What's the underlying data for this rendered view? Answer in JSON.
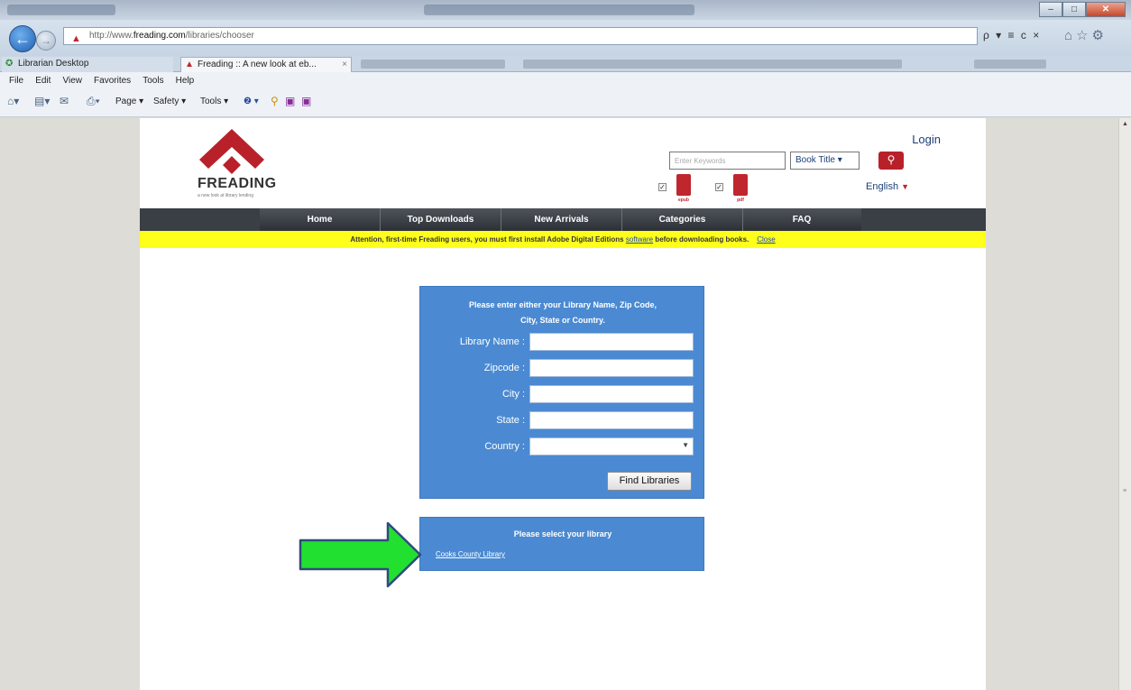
{
  "browser": {
    "address_url_prefix": "http://www.",
    "address_url_host": "freading.com",
    "address_url_path": "/libraries/chooser",
    "address_tools": "ρ ▾ ≡ c ×",
    "tabs": [
      {
        "label": "Librarian Desktop"
      },
      {
        "label": "Freading :: A new look at eb...",
        "close": "×"
      }
    ],
    "menu": [
      "File",
      "Edit",
      "View",
      "Favorites",
      "Tools",
      "Help"
    ],
    "commands": {
      "page": "Page ▾",
      "safety": "Safety ▾",
      "tools": "Tools ▾",
      "help": "❷ ▾"
    },
    "window_buttons": {
      "minimize": "–",
      "maximize": "□",
      "close": "✕"
    }
  },
  "site": {
    "logo_text": "FREADING",
    "logo_tagline": "a new look at library lending",
    "login_label": "Login",
    "search": {
      "keyword_placeholder": "Enter Keywords",
      "scope_label": "Book Title ▾",
      "button_icon": "search-icon"
    },
    "formats": [
      {
        "label": "epub"
      },
      {
        "label": "pdf"
      }
    ],
    "language": "English",
    "nav": [
      "Home",
      "Top Downloads",
      "New Arrivals",
      "Categories",
      "FAQ"
    ],
    "notice": {
      "text_before": "Attention, first-time Freading users, you must first install Adobe Digital Editions ",
      "link": "software",
      "text_after": " before downloading books.",
      "close": "Close"
    }
  },
  "library_search": {
    "title_line1": "Please enter either your Library Name, Zip Code,",
    "title_line2": "City, State or Country.",
    "fields": [
      {
        "label": "Library Name :",
        "value": ""
      },
      {
        "label": "Zipcode :",
        "value": ""
      },
      {
        "label": "City :",
        "value": ""
      },
      {
        "label": "State :",
        "value": ""
      },
      {
        "label": "Country :",
        "value": ""
      }
    ],
    "button": "Find Libraries"
  },
  "library_select": {
    "title": "Please select your library",
    "library": "Cooks County Library"
  },
  "colors": {
    "brand_red": "#c0262d",
    "form_blue": "#4b8ad2",
    "notice_yellow": "#ffff1c",
    "annotation_arrow": "#22e02f"
  }
}
